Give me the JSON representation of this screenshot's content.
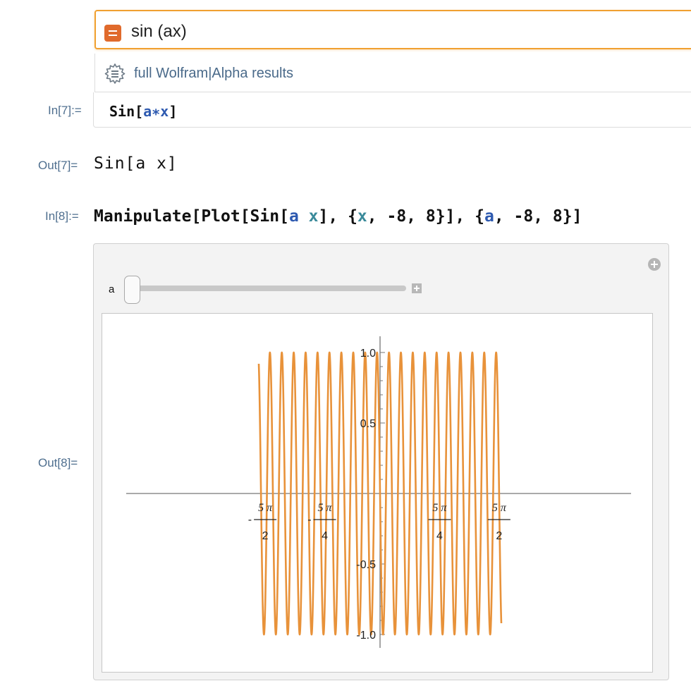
{
  "wolfram_alpha": {
    "query": "sin (ax)",
    "results_link": "full Wolfram|Alpha results"
  },
  "cells": {
    "in7": {
      "label": "In[7]:=",
      "code": {
        "fn": "Sin[",
        "a": "a",
        "op": "∗",
        "x": "x",
        "close": "]"
      }
    },
    "out7": {
      "label": "Out[7]=",
      "text": "Sin[a x]"
    },
    "in8": {
      "label": "In[8]:=",
      "code": {
        "p1": "Manipulate[Plot[Sin[",
        "a1": "a",
        "x1": "x",
        "p2": "], {",
        "x2": "x",
        "p3": ", -8, 8}], {",
        "a2": "a",
        "p4": ", -8, 8}]"
      }
    },
    "out8": {
      "label": "Out[8]="
    }
  },
  "manipulate": {
    "slider_label": "a",
    "slider_value": -8,
    "slider_min": -8,
    "slider_max": 8
  },
  "colors": {
    "curve": "#e8923a",
    "axis": "#777777",
    "accent": "#f0a030"
  },
  "chart_data": {
    "type": "line",
    "function": "Sin[a x]",
    "a": -8,
    "xlim": [
      -8,
      8
    ],
    "ylim": [
      -1,
      1
    ],
    "x_ticks": [
      {
        "value": -7.853981634,
        "num": "5 π",
        "den": "2",
        "neg": true
      },
      {
        "value": -3.926990817,
        "num": "5 π",
        "den": "4",
        "neg": true
      },
      {
        "value": 3.926990817,
        "num": "5 π",
        "den": "4",
        "neg": false
      },
      {
        "value": 7.853981634,
        "num": "5 π",
        "den": "2",
        "neg": false
      }
    ],
    "y_ticks": [
      {
        "value": 1.0,
        "label": "1.0"
      },
      {
        "value": 0.5,
        "label": "0.5"
      },
      {
        "value": -0.5,
        "label": "-0.5"
      },
      {
        "value": -1.0,
        "label": "-1.0"
      }
    ]
  }
}
